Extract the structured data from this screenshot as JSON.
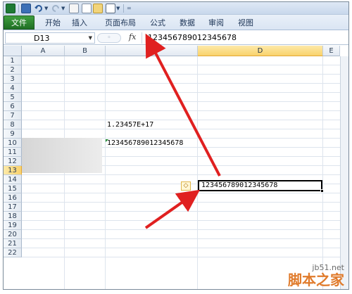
{
  "ribbon": {
    "tabs": [
      "文件",
      "开始",
      "插入",
      "页面布局",
      "公式",
      "数据",
      "审阅",
      "视图"
    ]
  },
  "formula_bar": {
    "name_box": "D13",
    "fx_label": "fx",
    "content": "'123456789012345678"
  },
  "columns": [
    "A",
    "B",
    "C",
    "D",
    "E"
  ],
  "rows": [
    "1",
    "2",
    "3",
    "4",
    "5",
    "6",
    "7",
    "8",
    "9",
    "10",
    "11",
    "12",
    "13",
    "14",
    "15",
    "16",
    "17",
    "18",
    "19",
    "20",
    "21",
    "22"
  ],
  "cells": {
    "c7": "1.23457E+17",
    "c9": "123456789012345678",
    "d13": "123456789012345678"
  },
  "watermark": {
    "url": "jb51.net",
    "text": "脚本之家"
  },
  "colors": {
    "arrow": "#e02020",
    "file_tab": "#2e8b34",
    "selection_header": "#f9d26c"
  }
}
